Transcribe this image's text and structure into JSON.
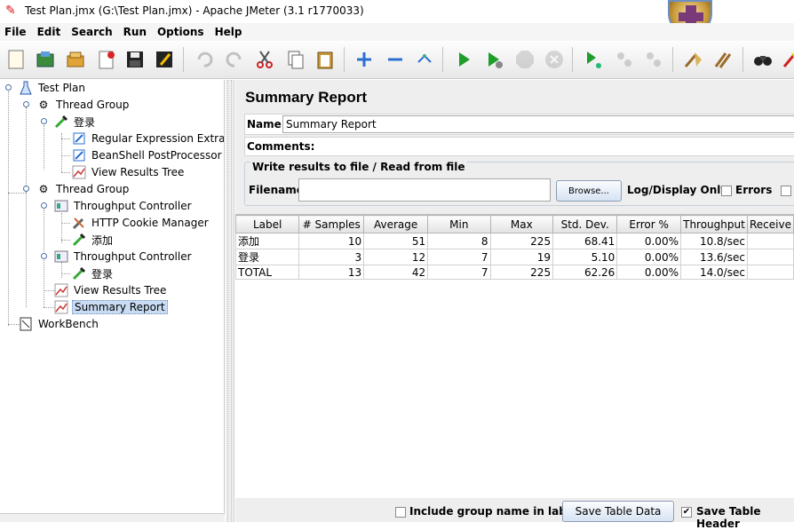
{
  "window": {
    "title": "Test Plan.jmx (G:\\Test Plan.jmx) - Apache JMeter (3.1 r1770033)"
  },
  "menu": [
    {
      "label": "File"
    },
    {
      "label": "Edit"
    },
    {
      "label": "Search"
    },
    {
      "label": "Run"
    },
    {
      "label": "Options"
    },
    {
      "label": "Help"
    }
  ],
  "toolbar": {
    "icons": [
      "new-icon",
      "templates-icon",
      "open-icon",
      "close-icon",
      "save-icon",
      "save-as-icon",
      "undo-icon",
      "redo-icon",
      "cut-icon",
      "copy-icon",
      "paste-icon",
      "expand-icon",
      "collapse-icon",
      "toggle-icon",
      "start-icon",
      "start-no-pause-icon",
      "stop-icon",
      "shutdown-icon",
      "remote-start-icon",
      "remote-stop-icon",
      "remote-shutdown-icon",
      "clear-icon",
      "clear-all-icon",
      "search-icon",
      "reset-search-icon"
    ]
  },
  "tree": {
    "nodes": [
      {
        "label": "Test Plan"
      },
      {
        "label": "Thread Group"
      },
      {
        "label": "登录"
      },
      {
        "label": "Regular Expression Extract"
      },
      {
        "label": "BeanShell PostProcessor"
      },
      {
        "label": "View Results Tree"
      },
      {
        "label": "Thread Group"
      },
      {
        "label": "Throughput Controller"
      },
      {
        "label": "HTTP Cookie Manager"
      },
      {
        "label": "添加"
      },
      {
        "label": "Throughput Controller"
      },
      {
        "label": "登录"
      },
      {
        "label": "View Results Tree"
      },
      {
        "label": "Summary Report"
      },
      {
        "label": "WorkBench"
      }
    ]
  },
  "panel": {
    "title": "Summary Report",
    "name_label": "Name:",
    "name_value": "Summary Report",
    "comments_label": "Comments:",
    "file_group_legend": "Write results to file / Read from file",
    "filename_label": "Filename",
    "filename_value": "",
    "browse_label": "Browse...",
    "log_display_label": "Log/Display Only:",
    "errors_label": "Errors"
  },
  "table": {
    "columns": [
      "Label",
      "# Samples",
      "Average",
      "Min",
      "Max",
      "Std. Dev.",
      "Error %",
      "Throughput",
      "Receive"
    ],
    "rows": [
      [
        "添加",
        "10",
        "51",
        "8",
        "225",
        "68.41",
        "0.00%",
        "10.8/sec",
        ""
      ],
      [
        "登录",
        "3",
        "12",
        "7",
        "19",
        "5.10",
        "0.00%",
        "13.6/sec",
        ""
      ],
      [
        "TOTAL",
        "13",
        "42",
        "7",
        "225",
        "62.26",
        "0.00%",
        "14.0/sec",
        ""
      ]
    ]
  },
  "bottom": {
    "include_group_label": "Include group name in label?",
    "save_table_data_label": "Save Table Data",
    "save_table_header_label": "Save Table Header",
    "save_table_header_checked": "✔"
  }
}
